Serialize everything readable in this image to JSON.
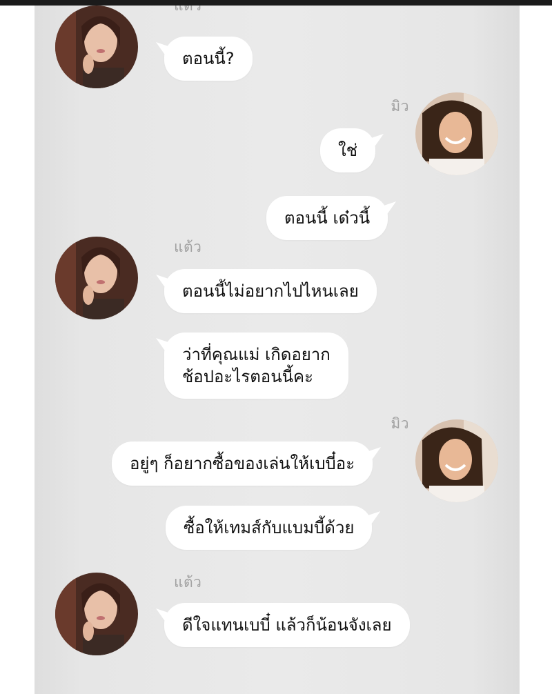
{
  "chat": {
    "messages": [
      {
        "sender": "left",
        "text": "ตอนนี้?"
      },
      {
        "sender": "right",
        "name": "มิว",
        "text": "ใช่"
      },
      {
        "sender": "right",
        "text": "ตอนนี้ เด๋วนี้"
      },
      {
        "sender": "left",
        "name": "แต้ว",
        "text": "ตอนนี้ไม่อยากไปไหนเลย"
      },
      {
        "sender": "left",
        "lines": [
          "ว่าที่คุณแม่ เกิดอยาก",
          "ช้อปอะไรตอนนี้คะ"
        ]
      },
      {
        "sender": "right",
        "name": "มิว",
        "text": "อยู่ๆ ก็อยากซื้อของเล่นให้เบบี๋อะ"
      },
      {
        "sender": "right",
        "text": "ซื้อให้เทมส์กับแบมบี้ด้วย"
      },
      {
        "sender": "left",
        "name": "แต้ว",
        "text": "ดีใจแทนเบบี๋ แล้วก็น้อนจังเลย"
      }
    ],
    "top_partial_name": "แต้ว"
  },
  "avatars": {
    "left_icon": "woman-portrait-avatar",
    "right_icon": "smiling-woman-portrait-avatar"
  }
}
